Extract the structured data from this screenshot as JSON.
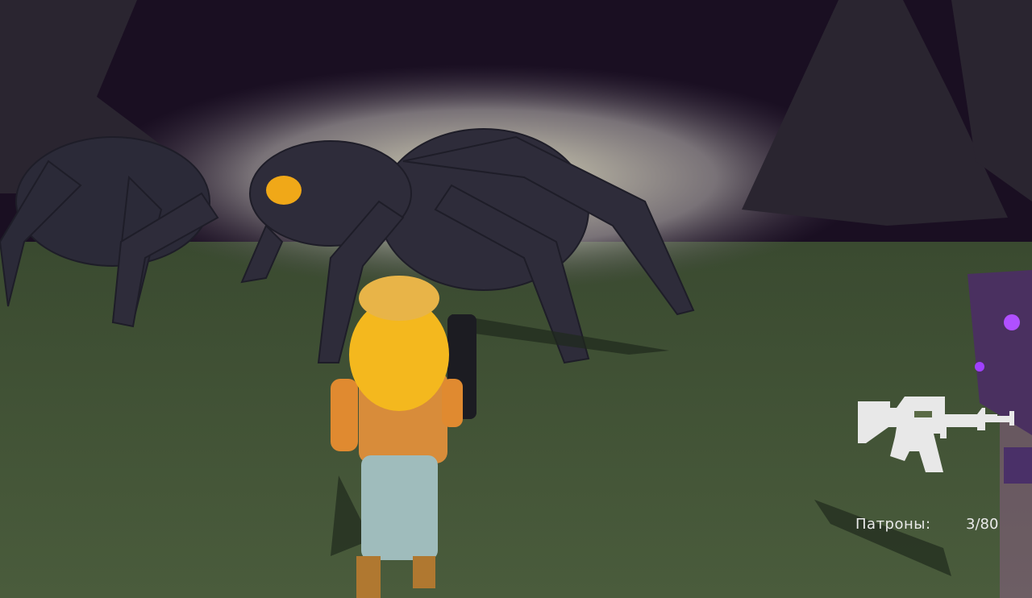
{
  "hud": {
    "weapon_icon": "assault-rifle-icon",
    "ammo_label": "Патроны:",
    "ammo_value": "3/80"
  },
  "colors": {
    "sky": "#1a0f22",
    "ground": "#4a5a3a",
    "fog": "#d8d6b8",
    "spider": "#2e2c3a",
    "spider_eye": "#f0a818",
    "hud_text": "#eaeaea",
    "crystal": "#9a40ff"
  }
}
